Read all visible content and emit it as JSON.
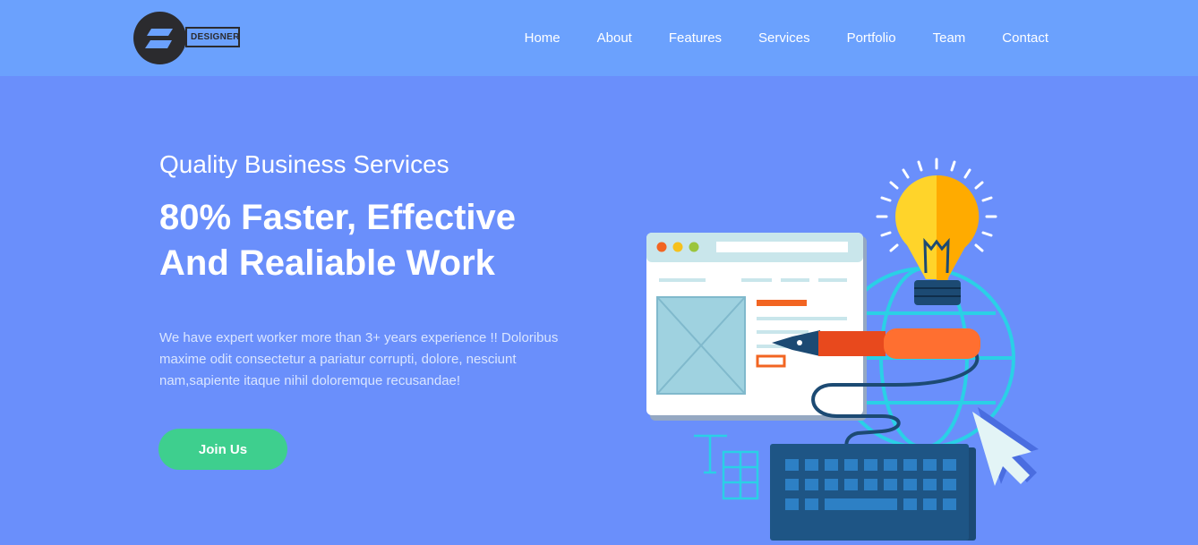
{
  "header": {
    "logo_text": "DESIGNER",
    "nav": [
      "Home",
      "About",
      "Features",
      "Services",
      "Portfolio",
      "Team",
      "Contact"
    ]
  },
  "hero": {
    "subtitle": "Quality Business Services",
    "title_line1": "80% Faster, Effective",
    "title_line2": "And Realiable Work",
    "description": "We have expert worker more than 3+ years experience !! Doloribus maxime odit consectetur a pariatur corrupti, dolore, nesciunt nam,sapiente itaque nihil doloremque recusandae!",
    "cta_label": "Join Us"
  },
  "colors": {
    "header_bg": "#6ba1fd",
    "hero_bg": "#6a8ffb",
    "cta_bg": "#3ecf8e"
  },
  "icons": [
    "logo-icon",
    "lightbulb-icon",
    "browser-window-icon",
    "pen-icon",
    "keyboard-icon",
    "cursor-icon",
    "text-tool-icon"
  ]
}
